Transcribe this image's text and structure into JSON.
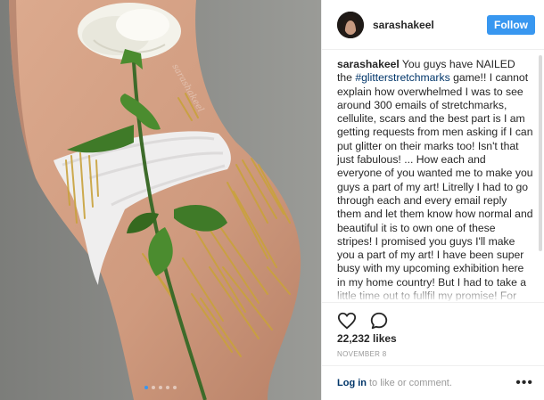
{
  "post": {
    "username": "sarashakeel",
    "follow_label": "Follow",
    "caption": {
      "user": "sarashakeel",
      "before_tag": "You guys have NAILED the ",
      "tag": "#glitterstretchmarks",
      "after_tag": " game!! I cannot explain how overwhelmed I was to see around 300 emails of stretchmarks, cellulite, scars and the best part is I am getting requests from men asking if I can put glitter on their marks too! Isn't that just fabulous! ... How each and everyone of you wanted me to make you guys a part of my art! Litrelly I had to go through each and every email reply them and let them know how normal and beautiful it is to own one of these stripes! I promised you guys I'll make you a part of my art! I have been super busy with my upcoming exhibition here in my home country! But I had to take a little time out to fullfil my promise! For those who are still waiting , Do look into my stories and you might find your edit! Thank you once again for being"
    },
    "likes": "22,232 likes",
    "date": "NOVEMBER 8",
    "footer": {
      "login": "Log in",
      "rest": "to like or comment.",
      "more": "•••"
    },
    "watermark": "sarashakeel",
    "carousel": {
      "count": 5,
      "active": 0
    }
  },
  "icons": {
    "like": "heart-outline-icon",
    "comment": "comment-bubble-icon",
    "more": "more-options-icon"
  },
  "colors": {
    "accent": "#3897f0",
    "link": "#003569",
    "muted": "#999999",
    "gold": "#c9a23c"
  }
}
